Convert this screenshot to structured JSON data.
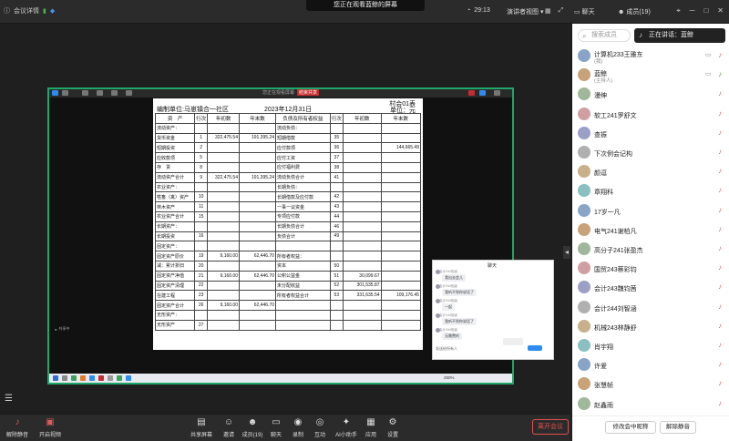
{
  "topbar": {
    "meeting_label": "会议详情",
    "banner": "您正在观看蓝鲸的屏幕",
    "timer": "29:13",
    "view_mode": "演讲者视图",
    "chat_tab": "聊天",
    "members_tab": "成员(19)"
  },
  "share": {
    "badge_name": "您正在观看屏幕",
    "badge_tag": "结束共享",
    "left_pill": "共享中",
    "zoom": "250%"
  },
  "doc": {
    "code": "村会01表",
    "unit_label": "单位：元",
    "org": "编制单位:马崽镇合一社区",
    "date": "2023年12月31日",
    "headers": [
      "资　产",
      "行次",
      "年初数",
      "年末数",
      "负债及所有者权益",
      "行次",
      "年初数",
      "年末数"
    ],
    "rows": [
      [
        "流动资产：",
        "",
        "",
        "",
        "流动负债：",
        "",
        "",
        ""
      ],
      [
        "货币资金",
        "1",
        "322,475.54",
        "191,395.24",
        "短期借款",
        "35",
        "",
        ""
      ],
      [
        "短期投资",
        "2",
        "",
        "",
        "应付款项",
        "36",
        "",
        "144,665.49"
      ],
      [
        "应收款项",
        "5",
        "",
        "",
        "应付工资",
        "37",
        "",
        ""
      ],
      [
        "存　货",
        "8",
        "",
        "",
        "应付福利费",
        "38",
        "",
        ""
      ],
      [
        "流动资产合计",
        "9",
        "322,475.54",
        "191,395.24",
        "流动负债合计",
        "41",
        "",
        ""
      ],
      [
        "农业资产：",
        "",
        "",
        "",
        "长期负债：",
        "",
        "",
        ""
      ],
      [
        "牲畜（禽）资产",
        "10",
        "",
        "",
        "长期借款及应付款",
        "42",
        "",
        ""
      ],
      [
        "林木资产",
        "11",
        "",
        "",
        "一事一议资金",
        "43",
        "",
        ""
      ],
      [
        "农业资产合计",
        "15",
        "",
        "",
        "专项应付款",
        "44",
        "",
        ""
      ],
      [
        "长期资产：",
        "",
        "",
        "",
        "长期负债合计",
        "46",
        "",
        ""
      ],
      [
        "长期投资",
        "16",
        "",
        "",
        "负债合计",
        "49",
        "",
        ""
      ],
      [
        "固定资产：",
        "",
        "",
        "",
        "",
        "",
        "",
        ""
      ],
      [
        "固定资产原价",
        "19",
        "9,160.00",
        "62,446.70",
        "所有者权益：",
        "",
        "",
        ""
      ],
      [
        "减：累计折旧",
        "20",
        "",
        "",
        "资本",
        "50",
        "",
        ""
      ],
      [
        "固定资产净值",
        "21",
        "9,160.00",
        "62,446.70",
        "公积公益金",
        "51",
        "30,099.67",
        ""
      ],
      [
        "固定资产清理",
        "22",
        "",
        "",
        "未分配收益",
        "52",
        "301,535.87",
        ""
      ],
      [
        "在建工程",
        "23",
        "",
        "",
        "所有者权益合计",
        "53",
        "331,635.54",
        "109,176.45"
      ],
      [
        "固定资产合计",
        "26",
        "9,160.00",
        "62,446.70",
        "",
        "",
        "",
        ""
      ],
      [
        "无形资产：",
        "",
        "",
        "",
        "",
        "",
        "",
        ""
      ],
      [
        "无形资产",
        "27",
        "",
        "",
        "",
        "",
        "",
        ""
      ]
    ]
  },
  "chatpop": {
    "title": "聊天",
    "messages": [
      {
        "name": "会计244班级",
        "text": "我出去会儿"
      },
      {
        "name": "会计244班级",
        "text": "我听不到你说话了"
      },
      {
        "name": "会计244班级",
        "text": "一起"
      },
      {
        "name": "会计244班级",
        "text": "我听不到你说话了"
      },
      {
        "name": "会计244班级",
        "text": "无需费的"
      }
    ],
    "input_placeholder": "发送给所有人"
  },
  "bottombar": {
    "mute": "解除静音",
    "video": "开启视频",
    "share": "共享屏幕",
    "invite": "邀请",
    "members": "成员(19)",
    "chat": "聊天",
    "record": "录制",
    "interact": "互动",
    "ai": "AI小助手",
    "apps": "应用",
    "settings": "设置",
    "leave": "离开会议"
  },
  "panel": {
    "search_placeholder": "搜索成员",
    "speaking_label": "正在讲话：蓝鲸",
    "members": [
      {
        "name": "计算机233王雅东",
        "sub": "(我)",
        "mute": true
      },
      {
        "name": "蓝鲸",
        "sub": "(主持人)",
        "mute": false,
        "speaking": true
      },
      {
        "name": "漫绅",
        "mute": true
      },
      {
        "name": "软工241罗舒文",
        "mute": true
      },
      {
        "name": "查振",
        "mute": true
      },
      {
        "name": "下次例会记构",
        "mute": true
      },
      {
        "name": "颜逗",
        "mute": true
      },
      {
        "name": "章翔科",
        "mute": true
      },
      {
        "name": "17岁一凡",
        "mute": true
      },
      {
        "name": "电气241谢柏凡",
        "mute": true
      },
      {
        "name": "高分子241张盈杰",
        "mute": true
      },
      {
        "name": "国贸243蔡彩钧",
        "mute": true
      },
      {
        "name": "会计243魏钧茜",
        "mute": true
      },
      {
        "name": "会计244刘智涵",
        "mute": true
      },
      {
        "name": "机械243林静舒",
        "mute": true
      },
      {
        "name": "肖宇翔",
        "mute": true
      },
      {
        "name": "许爱",
        "mute": true
      },
      {
        "name": "张慧帧",
        "mute": true
      },
      {
        "name": "赵鑫雨",
        "mute": true
      }
    ],
    "rename_button": "修改会中昵称",
    "unmute_button": "解除静音"
  },
  "colors": {
    "accent": "#1fa66a",
    "leave": "#e05050",
    "mute": "#e05a5a"
  }
}
